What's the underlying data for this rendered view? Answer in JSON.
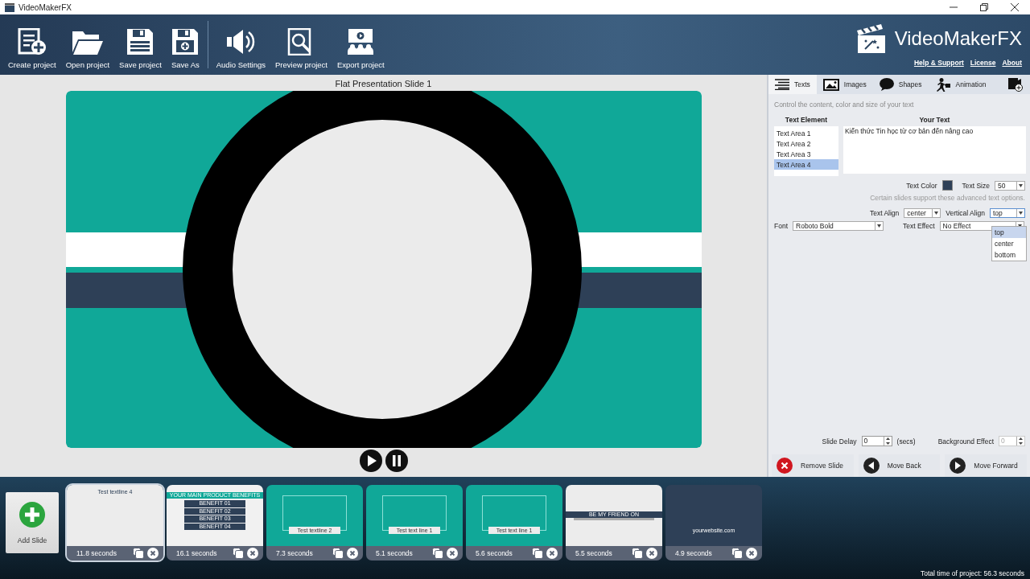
{
  "window": {
    "title": "VideoMakerFX"
  },
  "toolbar": [
    {
      "label": "Create project",
      "separator_before": false
    },
    {
      "label": "Open project",
      "separator_before": false
    },
    {
      "label": "Save project",
      "separator_before": false
    },
    {
      "label": "Save As",
      "separator_before": false
    },
    {
      "label": "Audio Settings",
      "separator_before": true
    },
    {
      "label": "Preview project",
      "separator_before": false
    },
    {
      "label": "Export project",
      "separator_before": false
    }
  ],
  "brand": {
    "name": "VideoMakerFX",
    "links": [
      "Help & Support",
      "License",
      "About"
    ]
  },
  "preview": {
    "title": "Flat Presentation Slide 1"
  },
  "panel": {
    "tabs": [
      {
        "label": "Texts",
        "selected": true
      },
      {
        "label": "Images",
        "selected": false
      },
      {
        "label": "Shapes",
        "selected": false
      },
      {
        "label": "Animation",
        "selected": false
      }
    ],
    "hint": "Control the content, color and size of your text",
    "text_elements": {
      "heading": "Text Element",
      "items": [
        {
          "label": "Text Area 1",
          "selected": false
        },
        {
          "label": "Text Area 2",
          "selected": false
        },
        {
          "label": "Text Area 3",
          "selected": false
        },
        {
          "label": "Text Area 4",
          "selected": true
        }
      ]
    },
    "your_text": {
      "heading": "Your Text",
      "value": "Kiến thức Tin học từ cơ bản đến nâng cao"
    },
    "text_color": {
      "label": "Text Color",
      "color": "#2e4057"
    },
    "text_size": {
      "label": "Text Size",
      "value": "50"
    },
    "advanced_note": "Certain slides support these advanced text options.",
    "text_align": {
      "label": "Text Align",
      "value": "center"
    },
    "vertical_align": {
      "label": "Vertical Align",
      "value": "top",
      "expanded": true,
      "options": [
        {
          "label": "top",
          "selected": true
        },
        {
          "label": "center",
          "selected": false
        },
        {
          "label": "bottom",
          "selected": false
        }
      ]
    },
    "font": {
      "label": "Font",
      "value": "Roboto Bold"
    },
    "text_effect": {
      "label": "Text Effect",
      "value": "No Effect"
    },
    "slide_delay": {
      "label": "Slide Delay",
      "value": "0",
      "unit": "(secs)"
    },
    "background_effect": {
      "label": "Background Effect",
      "value": "0",
      "disabled": true
    },
    "actions": [
      {
        "label": "Remove Slide",
        "kind": "remove"
      },
      {
        "label": "Move Back",
        "kind": "back"
      },
      {
        "label": "Move Forward",
        "kind": "forward"
      }
    ]
  },
  "filmstrip": {
    "add_label": "Add Slide",
    "slides": [
      {
        "kind": "blank",
        "selected": true,
        "duration": "11.8 seconds",
        "texts": [
          "Test textline 4"
        ]
      },
      {
        "kind": "benefits",
        "selected": false,
        "duration": "16.1 seconds",
        "texts": [
          "YOUR MAIN PRODUCT BENEFITS",
          "BENEFIT 01",
          "BENEFIT 02",
          "BENEFIT 03",
          "BENEFIT 04"
        ]
      },
      {
        "kind": "frame",
        "selected": false,
        "duration": "7.3 seconds",
        "texts": [
          "Test textline 2"
        ]
      },
      {
        "kind": "frame",
        "selected": false,
        "duration": "5.1 seconds",
        "texts": [
          "Test text line 1"
        ]
      },
      {
        "kind": "frame",
        "selected": false,
        "duration": "5.6 seconds",
        "texts": [
          "Test text line 1"
        ]
      },
      {
        "kind": "social",
        "selected": false,
        "duration": "5.5 seconds",
        "texts": [
          "BE MY FRIEND ON"
        ]
      },
      {
        "kind": "website",
        "selected": false,
        "duration": "4.9 seconds",
        "texts": [
          "yourwebsite.com"
        ]
      }
    ],
    "total": "Total time of project: 56.3 seconds"
  }
}
